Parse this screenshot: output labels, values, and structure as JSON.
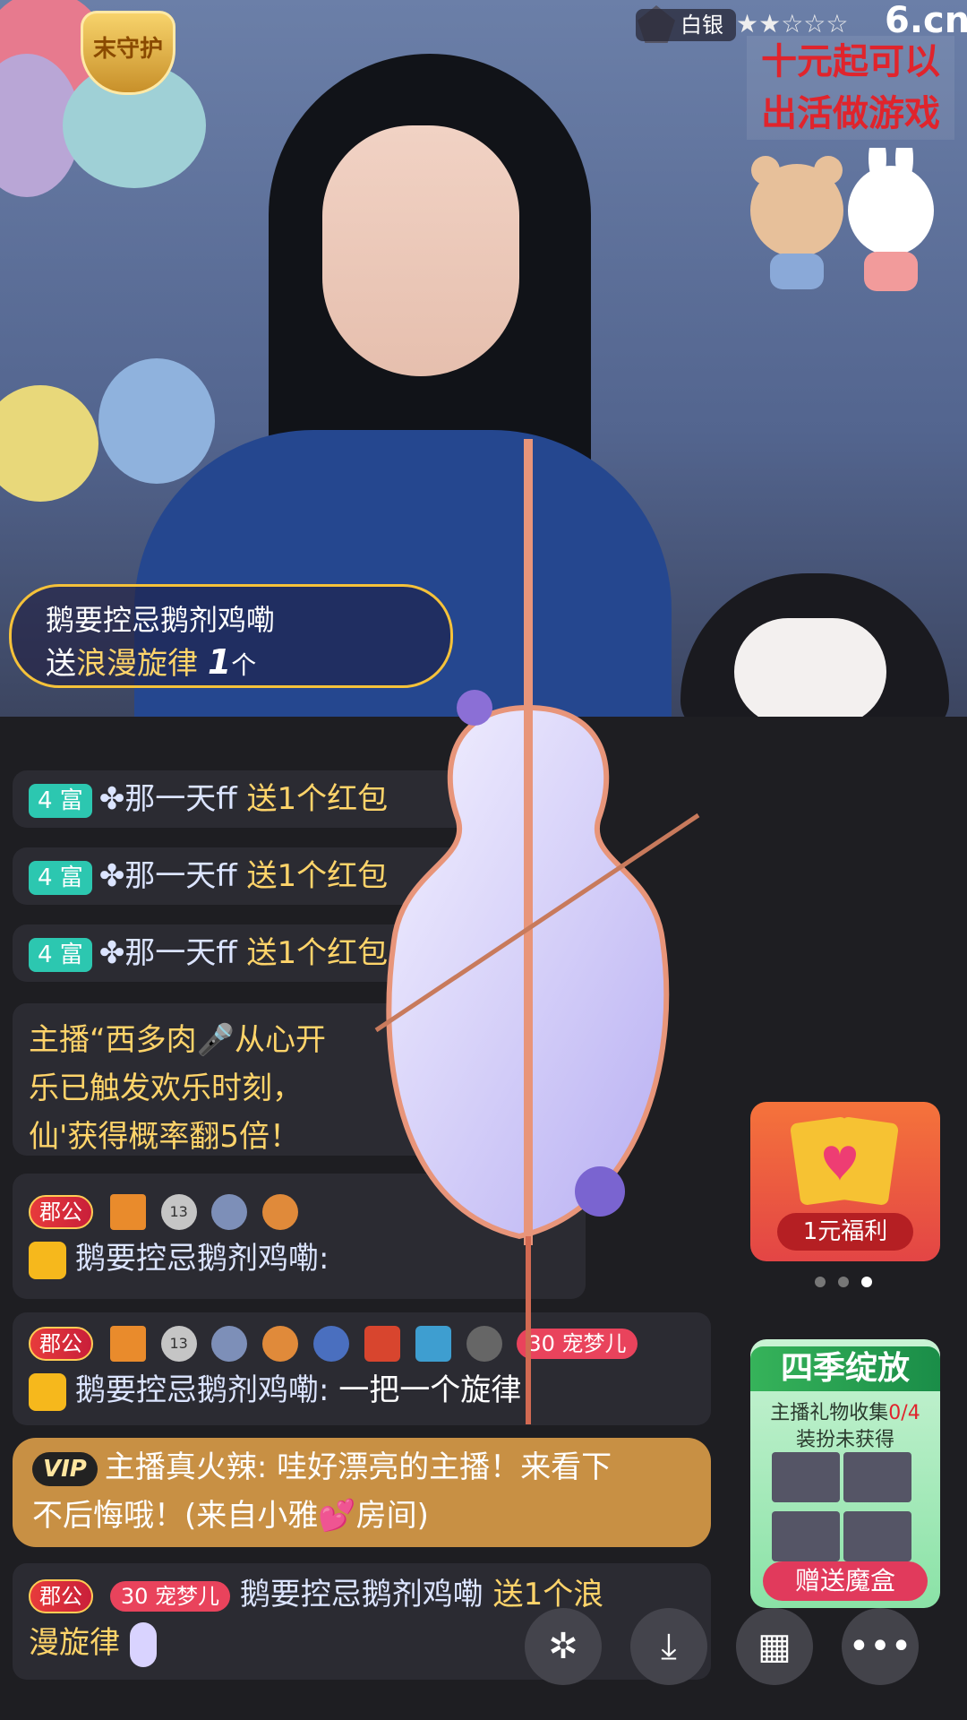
{
  "video": {
    "badge_guard": "末守护",
    "rank_label": "白银",
    "stars": "★★☆☆☆",
    "logo": "6.cn",
    "promo_line1": "十元起可以",
    "promo_line2": "出活做游戏"
  },
  "gift_popup": {
    "sender": "鹅要控忌鹅剂鸡嘞",
    "verb": "送",
    "gift": "浪漫旋律",
    "count": "1",
    "unit": "个"
  },
  "chat": {
    "rich_rows": [
      {
        "tag": "4 富",
        "name": "✤那一天ff",
        "text": "送1个红包"
      },
      {
        "tag": "4 富",
        "name": "✤那一天ff",
        "text": "送1个红包"
      },
      {
        "tag": "4 富",
        "name": "✤那一天ff",
        "text": "送1个红包"
      }
    ],
    "anchor_msg": {
      "l1": "主播“西多肉🎤从心开",
      "l2": "乐已触发欢乐时刻，",
      "l3": "仙'获得概率翻5倍！"
    },
    "user_msg1": {
      "tag": "郡公",
      "badge": "13",
      "name": "鹅要控忌鹅剂鸡嘞:"
    },
    "user_msg2": {
      "tag": "郡公",
      "badge": "13",
      "level": "30",
      "chong": "宠梦儿",
      "name": "鹅要控忌鹅剂鸡嘞:",
      "text": "一把一个旋律"
    },
    "vip_msg": {
      "tag": "VIP",
      "name": "主播真火辣:",
      "text1": "哇好漂亮的主播！来看下",
      "text2": "不后悔哦！(来自小雅💕房间)"
    },
    "gift_msg": {
      "tag": "郡公",
      "level": "30",
      "chong": "宠梦儿",
      "name": "鹅要控忌鹅剂鸡嘞",
      "text1": "送1个浪",
      "text2": "漫旋律"
    }
  },
  "promo_card": {
    "cta": "1元福利"
  },
  "season": {
    "title": "四季绽放",
    "line1": "主播礼物收集",
    "progress": "0/4",
    "line2": "装扮未获得",
    "btn": "赠送魔盒"
  },
  "colors": {
    "accent_gold": "#ffd46a",
    "rich_teal": "#2cc7b0",
    "vip_gold": "#c89044",
    "promo_red": "#e0242c"
  }
}
